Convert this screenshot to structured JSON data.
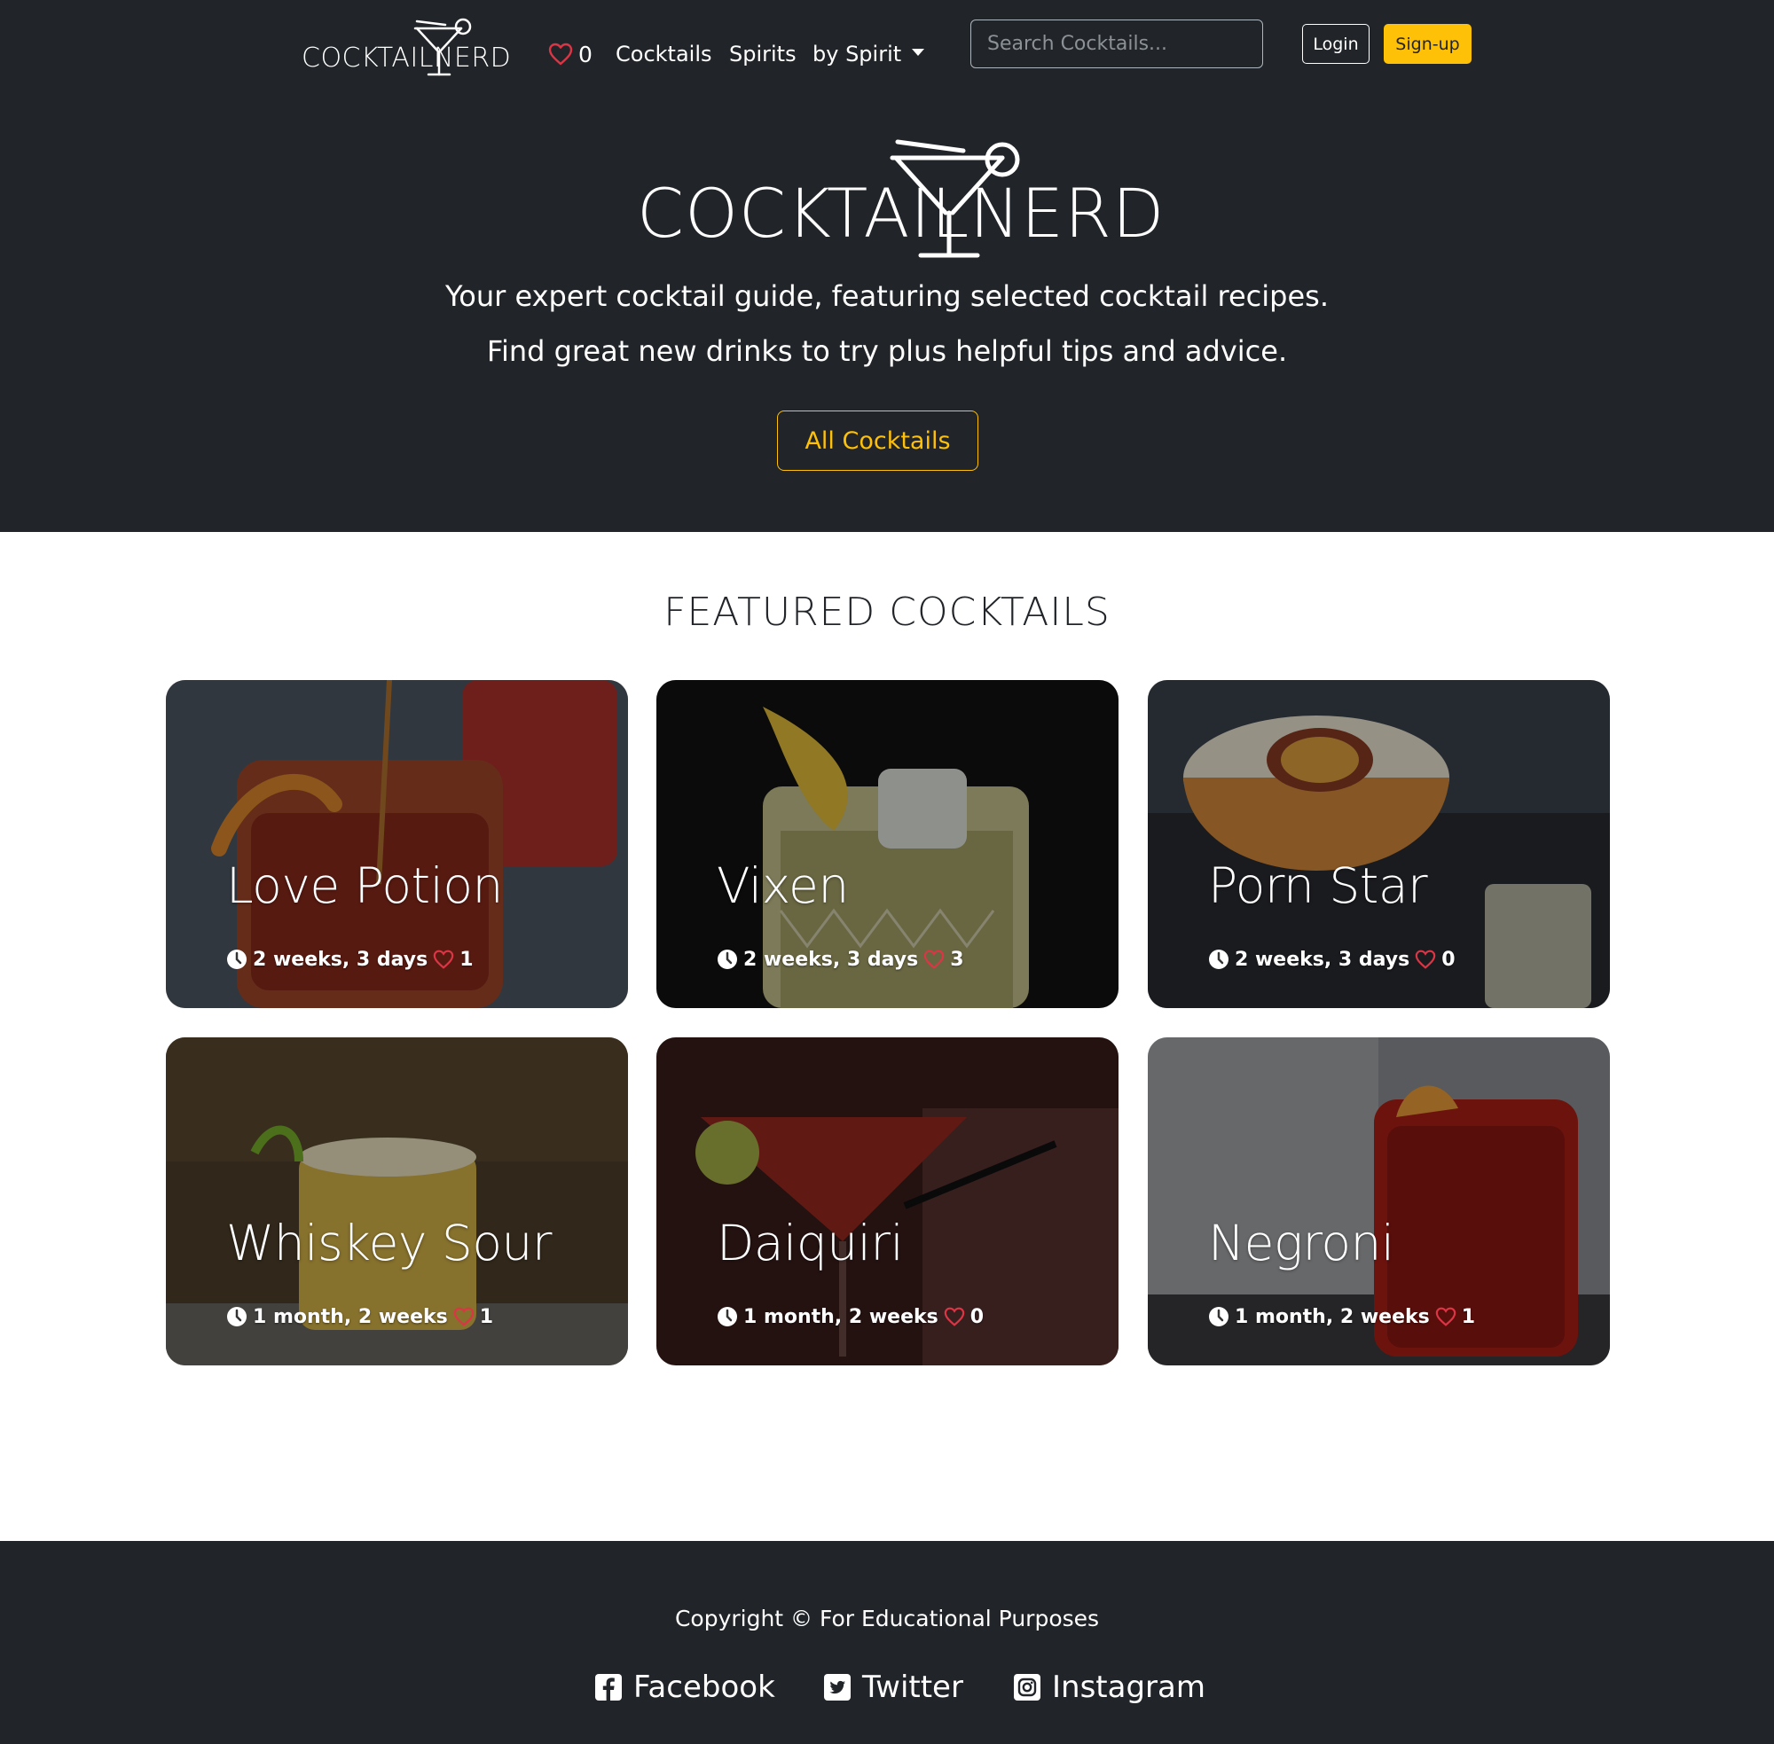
{
  "brand": {
    "logo_text": "COCKTAILNERD"
  },
  "nav": {
    "favorites_count": "0",
    "links": [
      "Cocktails",
      "Spirits",
      "by Spirit"
    ],
    "search_placeholder": "Search Cocktails...",
    "login_label": "Login",
    "signup_label": "Sign-up"
  },
  "hero": {
    "logo_text": "COCKTAILNERD",
    "line1": "Your expert cocktail guide, featuring selected cocktail recipes.",
    "line2": "Find great new drinks to try plus helpful tips and advice.",
    "button_label": "All Cocktails"
  },
  "featured": {
    "title": "FEATURED COCKTAILS",
    "cards": [
      {
        "name": "Love Potion",
        "age": "2 weeks, 3 days",
        "likes": "1"
      },
      {
        "name": "Vixen",
        "age": "2 weeks, 3 days",
        "likes": "3"
      },
      {
        "name": "Porn Star",
        "age": "2 weeks, 3 days",
        "likes": "0"
      },
      {
        "name": "Whiskey Sour",
        "age": "1 month, 2 weeks",
        "likes": "1"
      },
      {
        "name": "Daiquiri",
        "age": "1 month, 2 weeks",
        "likes": "0"
      },
      {
        "name": "Negroni",
        "age": "1 month, 2 weeks",
        "likes": "1"
      }
    ]
  },
  "footer": {
    "copyright": "Copyright © For Educational Purposes",
    "social": [
      "Facebook",
      "Twitter",
      "Instagram"
    ]
  },
  "colors": {
    "dark": "#212529",
    "accent": "#ffc107",
    "heart": "#dc3545",
    "white": "#ffffff"
  },
  "icons": [
    "martini-glass-icon",
    "heart-icon",
    "chevron-down-icon",
    "clock-icon",
    "facebook-icon",
    "twitter-icon",
    "instagram-icon"
  ]
}
